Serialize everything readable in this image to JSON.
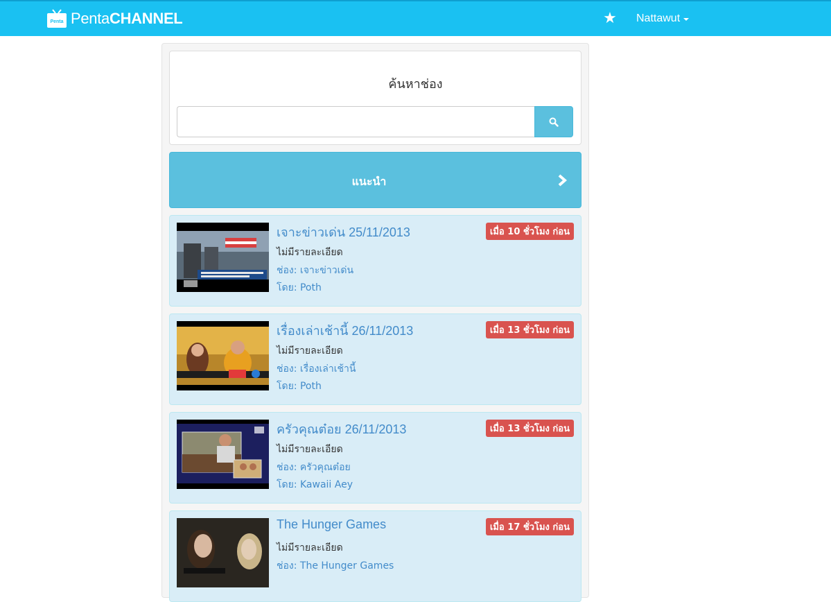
{
  "navbar": {
    "brand_text_part1": "Penta",
    "brand_text_part2": "CHANNEL",
    "brand_icon_text": "Penta",
    "favorites_icon": "star-icon",
    "user_name": "Nattawut"
  },
  "search": {
    "title": "ค้นหาช่อง",
    "input_value": "",
    "placeholder": "",
    "button_icon": "search-icon"
  },
  "recommend": {
    "label": "แนะนำ",
    "arrow_icon": "chevron-right-icon"
  },
  "videos": [
    {
      "title": "เจาะข่าวเด่น 25/11/2013",
      "time_badge": "เมื่อ 10 ชั่วโมง ก่อน",
      "description": "ไม่มีรายละเอียด",
      "channel": "ช่อง: เจาะข่าวเด่น",
      "author": "โดย: Poth"
    },
    {
      "title": "เรื่องเล่าเช้านี้ 26/11/2013",
      "time_badge": "เมื่อ 13 ชั่วโมง ก่อน",
      "description": "ไม่มีรายละเอียด",
      "channel": "ช่อง: เรื่องเล่าเช้านี้",
      "author": "โดย: Poth"
    },
    {
      "title": "ครัวคุณต๋อย 26/11/2013",
      "time_badge": "เมื่อ 13 ชั่วโมง ก่อน",
      "description": "ไม่มีรายละเอียด",
      "channel": "ช่อง: ครัวคุณต๋อย",
      "author": "โดย: Kawaii Aey"
    },
    {
      "title": "The Hunger Games",
      "time_badge": "เมื่อ 17 ชั่วโมง ก่อน",
      "description": "ไม่มีรายละเอียด",
      "channel": "ช่อง: The Hunger Games",
      "author": ""
    }
  ],
  "colors": {
    "navbar": "#1ac1f2",
    "info_button": "#5bc0de",
    "card_background": "#d9edf7",
    "badge": "#d9534f",
    "link": "#428bca"
  }
}
